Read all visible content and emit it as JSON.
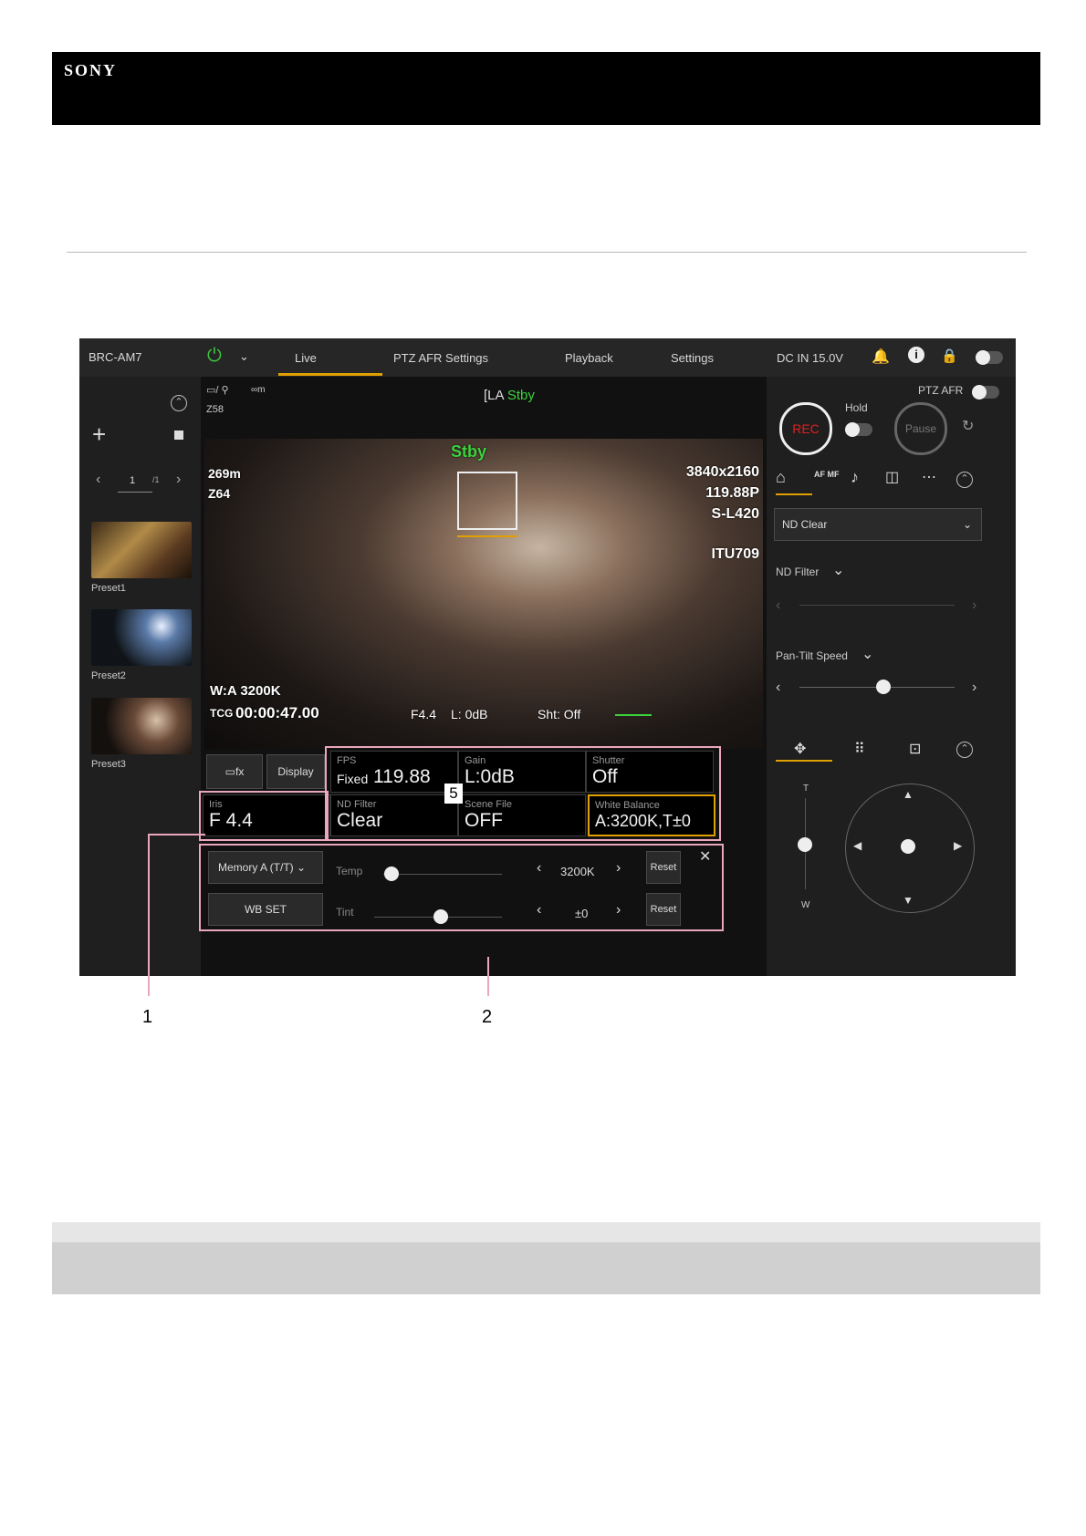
{
  "header": {
    "brand": "SONY"
  },
  "app": {
    "model": "BRC-AM7",
    "tabs": [
      "Live",
      "PTZ AFR Settings",
      "Playback",
      "Settings"
    ],
    "power_status": "DC IN 15.0V"
  },
  "presets": {
    "page_current": "1",
    "page_total": "/1",
    "items": [
      {
        "label": "Preset1"
      },
      {
        "label": "Preset2"
      },
      {
        "label": "Preset3"
      }
    ]
  },
  "monitor": {
    "top_info": {
      "distance": "∞m",
      "zoom": "Z58",
      "status": "Stby"
    },
    "overlay": {
      "status": "Stby",
      "distance": "269m",
      "zoom": "Z64",
      "resolution": "3840x2160",
      "framerate": "119.88P",
      "gamma": "S-L420",
      "colorspace": "ITU709",
      "wb": "W:A  3200K",
      "tc_label": "TCG",
      "timecode": "00:00:47.00",
      "iris": "F4.4",
      "level": "L:  0dB",
      "shutter": "Sht: Off"
    }
  },
  "controls": {
    "display_label": "Display",
    "fps": {
      "label": "FPS",
      "prefix": "Fixed",
      "value": "119.88"
    },
    "gain": {
      "label": "Gain",
      "value": "L:0dB"
    },
    "shutter": {
      "label": "Shutter",
      "value": "Off"
    },
    "iris": {
      "label": "Iris",
      "value": "F 4.4"
    },
    "nd_filter": {
      "label": "ND Filter",
      "value": "Clear"
    },
    "scene_file": {
      "label": "Scene File",
      "value": "OFF"
    },
    "white_balance": {
      "label": "White Balance",
      "value": "A:3200K,T±0"
    },
    "badge": "5"
  },
  "wb_panel": {
    "memory_select": "Memory A (T/T)",
    "wb_set": "WB SET",
    "temp_label": "Temp",
    "temp_value": "3200K",
    "tint_label": "Tint",
    "tint_value": "±0",
    "reset_label": "Reset"
  },
  "right_panel": {
    "ptz_afr_label": "PTZ AFR",
    "hold_label": "Hold",
    "rec_label": "REC",
    "pause_label": "Pause",
    "af_mf_label": "AF MF",
    "nd_select": "ND Clear",
    "nd_filter_label": "ND Filter",
    "pantilt_label": "Pan-Tilt Speed",
    "zoom_t": "T",
    "zoom_w": "W"
  },
  "callouts": [
    "1",
    "2"
  ],
  "colors": {
    "accent": "#e0a000",
    "rec_red": "#e02020",
    "callout_pink": "#e9a6bd",
    "status_green": "#3cd23c"
  }
}
